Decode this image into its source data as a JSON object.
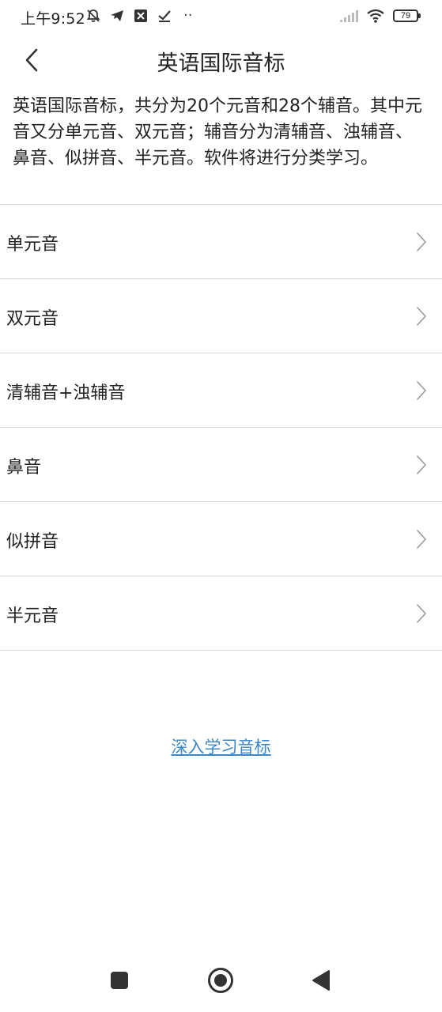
{
  "status_bar": {
    "time": "上午9:52",
    "dots": "··",
    "battery_level": "79",
    "icons": [
      "bell-off-icon",
      "send-icon",
      "sync-icon",
      "check-icon",
      "signal-icon",
      "wifi-icon",
      "battery-icon"
    ]
  },
  "header": {
    "title": "英语国际音标",
    "back_icon": "chevron-left-icon"
  },
  "description": "英语国际音标，共分为20个元音和28个辅音。其中元音又分单元音、双元音；辅音分为清辅音、浊辅音、鼻音、似拼音、半元音。软件将进行分类学习。",
  "menu": {
    "items": [
      {
        "label": "单元音"
      },
      {
        "label": "双元音"
      },
      {
        "label": "清辅音+浊辅音"
      },
      {
        "label": "鼻音"
      },
      {
        "label": "似拼音"
      },
      {
        "label": "半元音"
      }
    ],
    "chevron_icon": "chevron-right-icon"
  },
  "link": {
    "label": "深入学习音标",
    "color": "#3b86c6"
  },
  "nav_bar": {
    "icons": [
      "recents-square-icon",
      "home-circle-icon",
      "back-triangle-icon"
    ]
  }
}
